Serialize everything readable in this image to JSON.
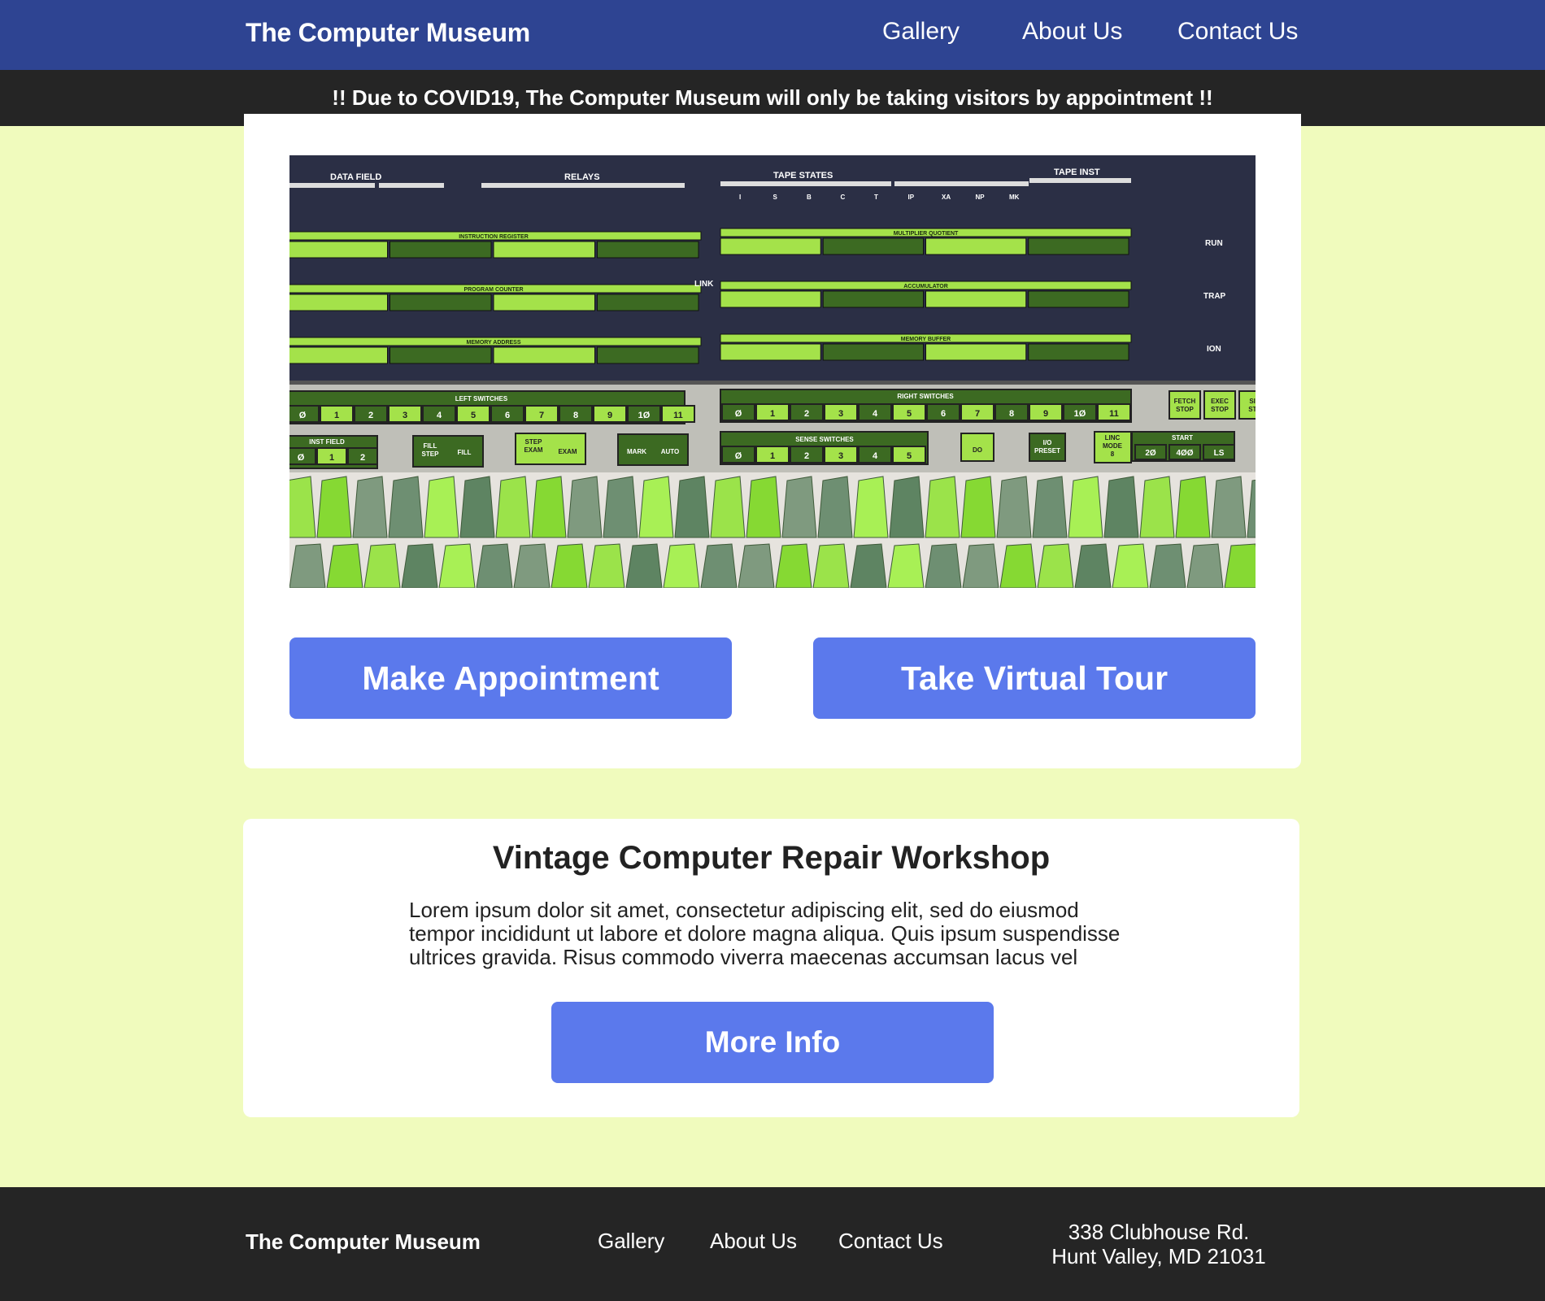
{
  "header": {
    "brand": "The Computer Museum",
    "nav": [
      "Gallery",
      "About Us",
      "Contact Us"
    ]
  },
  "alert": "!! Due to COVID19, The Computer Museum will only be taking visitors by appointment !!",
  "hero": {
    "image": "panel-switches-photo",
    "panel_labels": {
      "top": [
        "DATA FIELD",
        "RELAYS",
        "TAPE STATES",
        "TAPE INST"
      ],
      "tape_states": [
        "I",
        "S",
        "B",
        "C",
        "T",
        "IP",
        "XA",
        "NP",
        "MK"
      ],
      "left_regs": [
        "INSTRUCTION REGISTER",
        "PROGRAM COUNTER",
        "MEMORY ADDRESS"
      ],
      "right_regs": [
        "MULTIPLIER QUOTIENT",
        "ACCUMULATOR",
        "MEMORY BUFFER"
      ],
      "link": "LINK",
      "status": [
        "RUN",
        "TRAP",
        "ION"
      ],
      "left_switches": "LEFT SWITCHES",
      "right_switches": "RIGHT SWITCHES",
      "switch_numbers": [
        "Ø",
        "1",
        "2",
        "3",
        "4",
        "5",
        "6",
        "7",
        "8",
        "9",
        "1Ø",
        "11"
      ],
      "fetch": [
        "FETCH",
        "STOP"
      ],
      "exec": [
        "EXEC",
        "STOP"
      ],
      "sin": [
        "SIN",
        "STE"
      ],
      "inst_field": "INST FIELD",
      "inst_field_numbers": [
        "Ø",
        "1",
        "2"
      ],
      "fill": [
        "FILL",
        "STEP"
      ],
      "fill2": "FILL",
      "step": [
        "STEP",
        "EXAM"
      ],
      "exam": "EXAM",
      "mark": "MARK",
      "auto": "AUTO",
      "sense_switches": "SENSE SWITCHES",
      "sense_numbers": [
        "Ø",
        "1",
        "2",
        "3",
        "4",
        "5"
      ],
      "do": "DO",
      "io": [
        "I/O",
        "PRESET"
      ],
      "linc": [
        "LINC",
        "MODE",
        "8"
      ],
      "start": "START",
      "start_buttons": [
        "2Ø",
        "4ØØ",
        "LS"
      ]
    }
  },
  "actions": {
    "appointment": "Make Appointment",
    "tour": "Take Virtual Tour"
  },
  "workshop": {
    "title": "Vintage Computer Repair Workshop",
    "lines": [
      "Lorem ipsum dolor sit amet, consectetur adipiscing elit, sed do eiusmod",
      "tempor incididunt ut labore et dolore magna aliqua. Quis ipsum suspendisse",
      "ultrices gravida. Risus commodo viverra maecenas accumsan lacus vel"
    ],
    "button": "More Info"
  },
  "footer": {
    "brand": "The Computer Museum",
    "nav": [
      "Gallery",
      "About Us",
      "Contact Us"
    ],
    "address_line1": "338 Clubhouse Rd.",
    "address_line2": "Hunt Valley, MD 21031"
  },
  "colors": {
    "header_bg": "#2e4492",
    "alert_bg": "#252525",
    "page_bg": "#f0fbbd",
    "button": "#5b79ec",
    "panel_dark": "#2b2f45",
    "panel_green": "#a4e24a",
    "panel_dark_green": "#3c6a22"
  }
}
